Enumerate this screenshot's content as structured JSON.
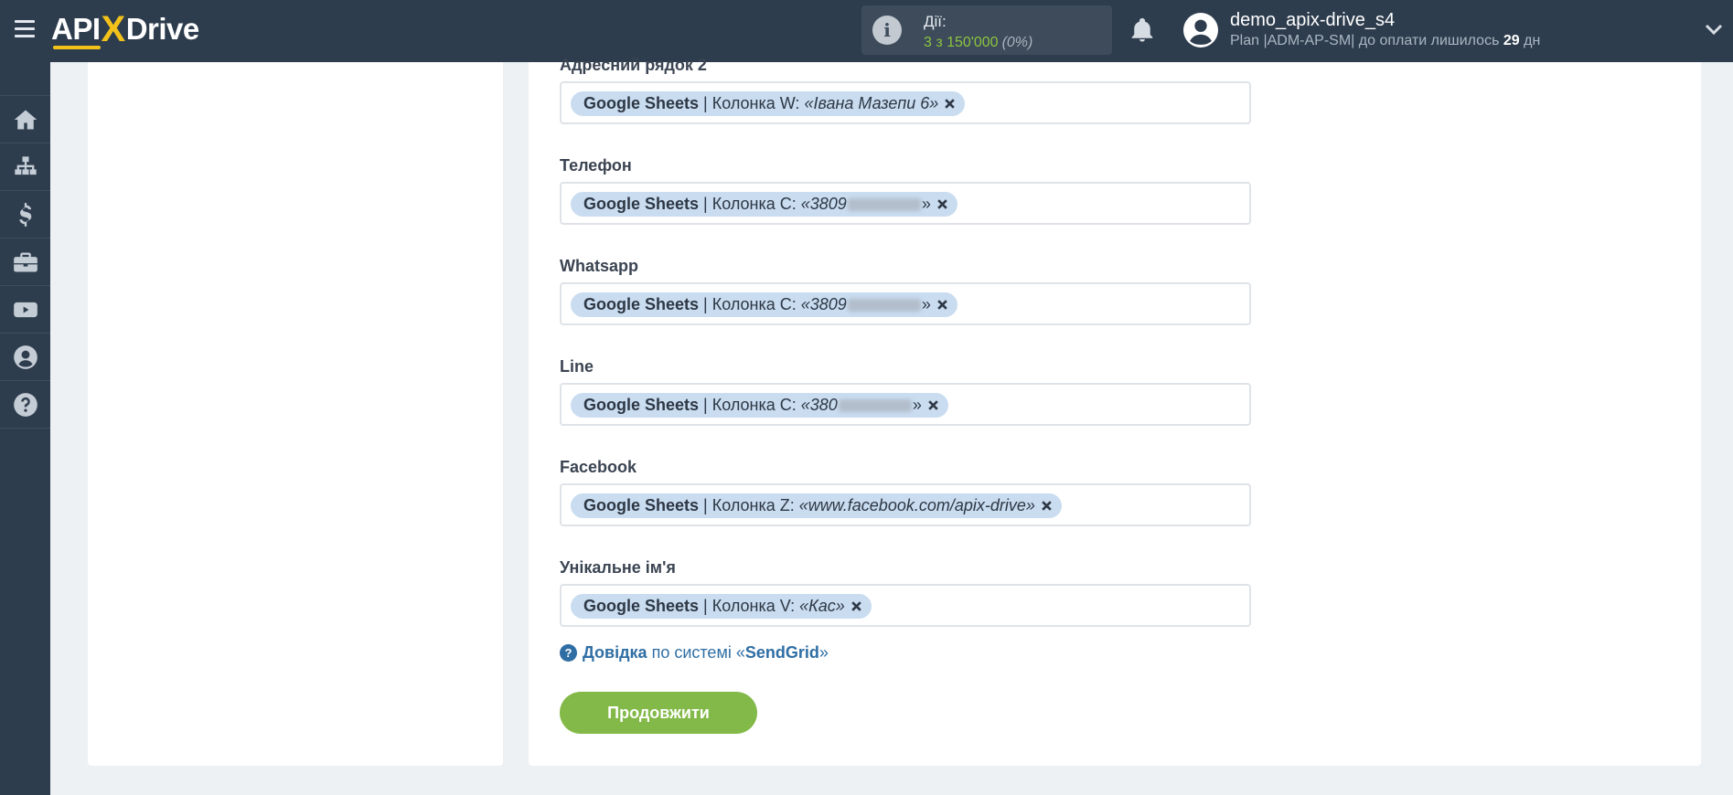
{
  "header": {
    "logo_api": "API",
    "logo_x": "X",
    "logo_drive": "Drive",
    "actions_title": "Дії:",
    "actions_count": "3 з 150'000",
    "actions_pct": "(0%)",
    "user_name": "demo_apix-drive_s4",
    "user_plan_prefix": "Plan |ADM-AP-SM| до оплати лишилось",
    "user_plan_days": "29",
    "user_plan_suffix": "дн"
  },
  "sidebar": {
    "items": [
      {
        "icon": "home-icon"
      },
      {
        "icon": "sitemap-icon"
      },
      {
        "icon": "dollar-icon"
      },
      {
        "icon": "briefcase-icon"
      },
      {
        "icon": "youtube-icon"
      },
      {
        "icon": "user-icon"
      },
      {
        "icon": "question-icon"
      }
    ]
  },
  "fields": [
    {
      "label": "Адресний рядок 2",
      "source": "Google Sheets",
      "column": "Колонка W:",
      "value": "«Івана Мазепи 6»",
      "blurred": false
    },
    {
      "label": "Телефон",
      "source": "Google Sheets",
      "column": "Колонка C:",
      "value_prefix": "«3809",
      "value_suffix": "»",
      "blurred": true
    },
    {
      "label": "Whatsapp",
      "source": "Google Sheets",
      "column": "Колонка C:",
      "value_prefix": "«3809",
      "value_suffix": "»",
      "blurred": true
    },
    {
      "label": "Line",
      "source": "Google Sheets",
      "column": "Колонка C:",
      "value_prefix": "«380",
      "value_suffix": "»",
      "blurred": true
    },
    {
      "label": "Facebook",
      "source": "Google Sheets",
      "column": "Колонка Z:",
      "value": "«www.facebook.com/apix-drive»",
      "blurred": false
    },
    {
      "label": "Унікальне ім'я",
      "source": "Google Sheets",
      "column": "Колонка V:",
      "value": "«Кас»",
      "blurred": false
    }
  ],
  "chip_separator": "|",
  "help": {
    "link": "Довідка",
    "middle": "по системі «",
    "system": "SendGrid",
    "end": "»"
  },
  "continue_label": "Продовжити"
}
